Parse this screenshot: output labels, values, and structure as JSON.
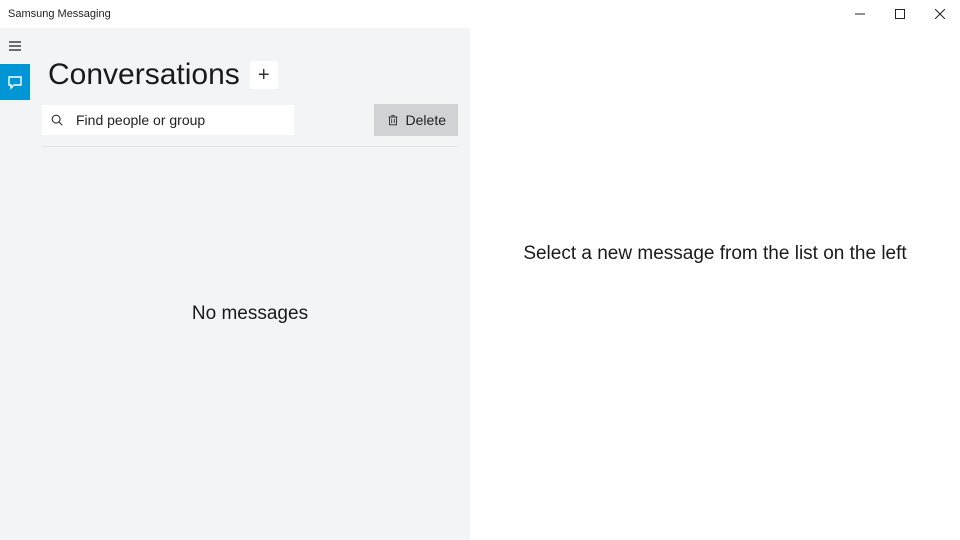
{
  "titlebar": {
    "title": "Samsung Messaging"
  },
  "leftPane": {
    "title": "Conversations",
    "search": {
      "placeholder": "Find people or group"
    },
    "deleteLabel": "Delete",
    "emptyText": "No messages"
  },
  "rightPane": {
    "emptyText": "Select a new message from the list on the left"
  }
}
